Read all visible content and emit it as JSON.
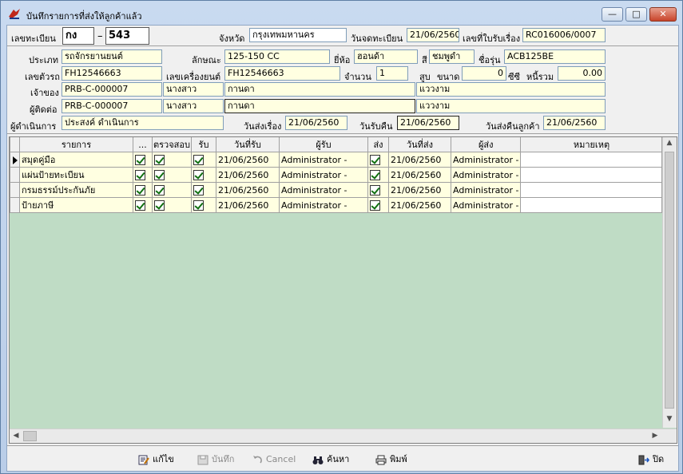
{
  "window": {
    "title": "บันทึกรายการที่ส่งให้ลูกค้าแล้ว",
    "minimize": "—",
    "maximize": "□",
    "close": "✕"
  },
  "header": {
    "reg_no_label": "เลขทะเบียน",
    "reg_prefix": "กง",
    "reg_dash": "–",
    "reg_number": "543",
    "province_label": "จังหวัด",
    "province": "กรุงเทพมหานคร",
    "reg_date_label": "วันจดทะเบียน",
    "reg_date": "21/06/2560",
    "receipt_label": "เลขที่ใบรับเรื่อง",
    "receipt_no": "RC016006/0007"
  },
  "vehicle": {
    "type_label": "ประเภท",
    "type": "รถจักรยานยนต์",
    "character_label": "ลักษณะ",
    "character": "125-150 CC",
    "brand_label": "ยี่ห้อ",
    "brand": "ฮอนด้า",
    "color_label": "สี",
    "color": "ชมพูดำ",
    "model_label": "ชื่อรุ่น",
    "model": "ACB125BE",
    "chassis_label": "เลขตัวรถ",
    "chassis": "FH12546663",
    "engine_label": "เลขเครื่องยนต์",
    "engine": "FH12546663",
    "qty_label": "จำนวน",
    "qty": "1",
    "cyl_label": "สูบ",
    "size_label": "ขนาด",
    "size": "0",
    "cc_label": "ซีซี",
    "debt_label": "หนี้รวม",
    "debt": "0.00",
    "owner_label": "เจ้าของ",
    "owner_code": "PRB-C-000007",
    "owner_title": "นางสาว",
    "owner_first": "กานดา",
    "owner_last": "แววงาม",
    "contact_label": "ผู้ติดต่อ",
    "contact_code": "PRB-C-000007",
    "contact_title": "นางสาว",
    "contact_first": "กานดา",
    "contact_last": "แววงาม",
    "operator_label": "ผู้ดำเนินการ",
    "operator": "ประสงค์ ดำเนินการ",
    "send_date_label": "วันส่งเรื่อง",
    "send_date": "21/06/2560",
    "return_date_label": "วันรับคืน",
    "return_date": "21/06/2560",
    "customer_return_label": "วันส่งคืนลูกค้า",
    "customer_return_date": "21/06/2560"
  },
  "grid": {
    "columns": [
      "รายการ",
      "...",
      "ตรวจสอบ",
      "รับ",
      "วันที่รับ",
      "ผู้รับ",
      "ส่ง",
      "วันที่ส่ง",
      "ผู้ส่ง",
      "หมายเหตุ"
    ],
    "rows": [
      {
        "item": "สมุดคู่มือ",
        "dots": true,
        "check": true,
        "receive": true,
        "recv_date": "21/06/2560",
        "receiver": "Administrator -",
        "send": true,
        "send_date": "21/06/2560",
        "sender": "Administrator -",
        "note": ""
      },
      {
        "item": "แผ่นป้ายทะเบียน",
        "dots": true,
        "check": true,
        "receive": true,
        "recv_date": "21/06/2560",
        "receiver": "Administrator -",
        "send": true,
        "send_date": "21/06/2560",
        "sender": "Administrator -",
        "note": ""
      },
      {
        "item": "กรมธรรม์ประกันภัย",
        "dots": true,
        "check": true,
        "receive": true,
        "recv_date": "21/06/2560",
        "receiver": "Administrator -",
        "send": true,
        "send_date": "21/06/2560",
        "sender": "Administrator -",
        "note": ""
      },
      {
        "item": "ป้ายภาษี",
        "dots": true,
        "check": true,
        "receive": true,
        "recv_date": "21/06/2560",
        "receiver": "Administrator -",
        "send": true,
        "send_date": "21/06/2560",
        "sender": "Administrator -",
        "note": ""
      }
    ]
  },
  "toolbar": {
    "edit": "แก้ไข",
    "save": "บันทึก",
    "cancel": "Cancel",
    "search": "ค้นหา",
    "print": "พิมพ์",
    "close": "ปิด"
  },
  "colors": {
    "field_bg": "#ffffe1",
    "grid_empty": "#bfdcc5",
    "check_green": "#107010"
  }
}
